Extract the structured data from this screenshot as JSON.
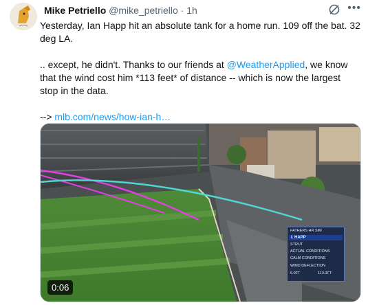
{
  "tweet": {
    "author_name": "Mike Petriello",
    "author_handle": "@mike_petriello",
    "separator": "·",
    "time": "1h",
    "more_label": "•••",
    "line1": "Yesterday, Ian Happ hit an absolute tank for a home run. 109 off the bat. 32 deg LA.",
    "line2_pre": ".. except, he didn't. Thanks to our friends at ",
    "line2_mention": "@WeatherApplied",
    "line2_post": ", we know that the wind cost him *113 feet* of distance -- which is now the largest stop in the data.",
    "line3_pre": "--> ",
    "line3_link": "mlb.com/news/how-ian-h…"
  },
  "video": {
    "duration": "0:06",
    "overlay": {
      "header": "FATHERS HR SIM",
      "player": "I. HAPP",
      "row1": "STRUT",
      "row2": "ACTUAL CONDITIONS",
      "row3": "CALM CONDITIONS",
      "row4_label": "WIND DEFLECTION",
      "row4_v1": "6.0FT",
      "row4_v2": "113.0FT"
    }
  },
  "colors": {
    "link": "#1d9bf0",
    "trajectory_actual": "#e040e0",
    "trajectory_calm": "#4fd6d0"
  }
}
